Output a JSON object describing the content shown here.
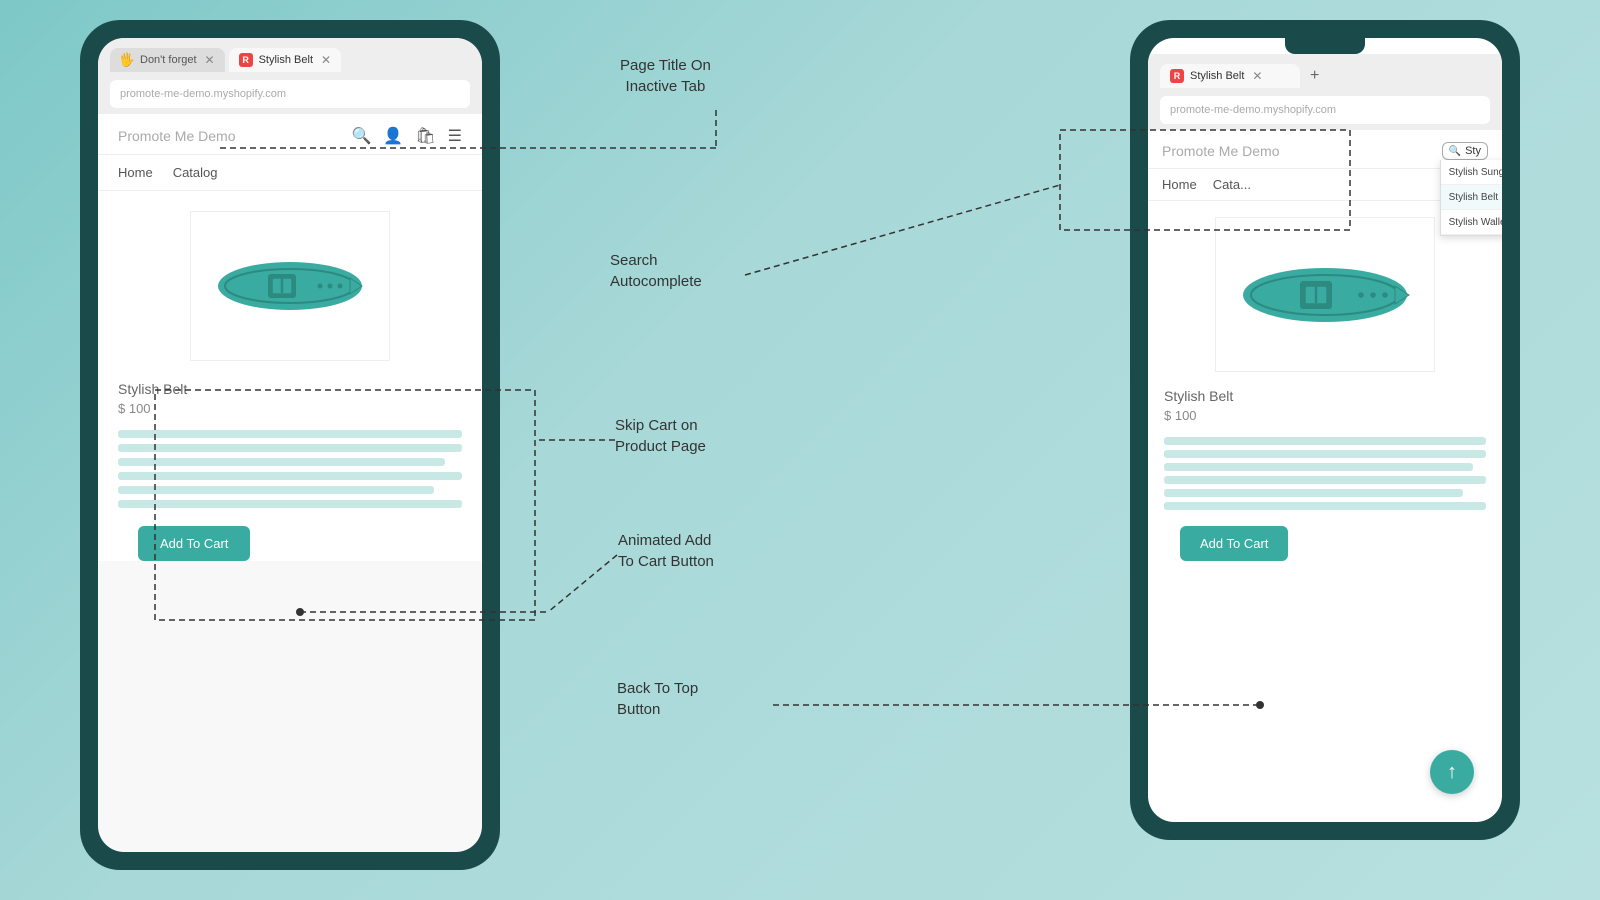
{
  "background": "#8ecece",
  "annotations": {
    "page_title": "Page Title On\nInactive Tab",
    "search_autocomplete": "Search\nAutocomplete",
    "skip_cart": "Skip Cart on\nProduct Page",
    "animated_add": "Animated Add\nTo Cart Button",
    "back_to_top": "Back To Top\nButton"
  },
  "left_phone": {
    "tabs": [
      {
        "label": "Don't forget",
        "active": false,
        "icon": "emoji-hand"
      },
      {
        "label": "Stylish Belt",
        "active": true,
        "icon": "r-logo"
      }
    ],
    "site_title": "Promote Me Demo",
    "nav_items": [
      "Home",
      "Catalog"
    ],
    "product": {
      "title": "Stylish Belt",
      "price": "$ 100",
      "add_to_cart_label": "Add To Cart"
    }
  },
  "right_phone": {
    "tab_label": "Stylish Belt",
    "site_title": "Promote Me Demo",
    "search_placeholder": "Sty",
    "nav_items": [
      "Home",
      "Cata..."
    ],
    "autocomplete_items": [
      {
        "label": "Stylish Sunglasses"
      },
      {
        "label": "Stylish Belt",
        "selected": true
      },
      {
        "label": "Stylish Wallet"
      }
    ],
    "product": {
      "title": "Stylish Belt",
      "price": "$ 100",
      "add_to_cart_label": "Add To Cart"
    },
    "back_to_top_arrow": "↑"
  }
}
